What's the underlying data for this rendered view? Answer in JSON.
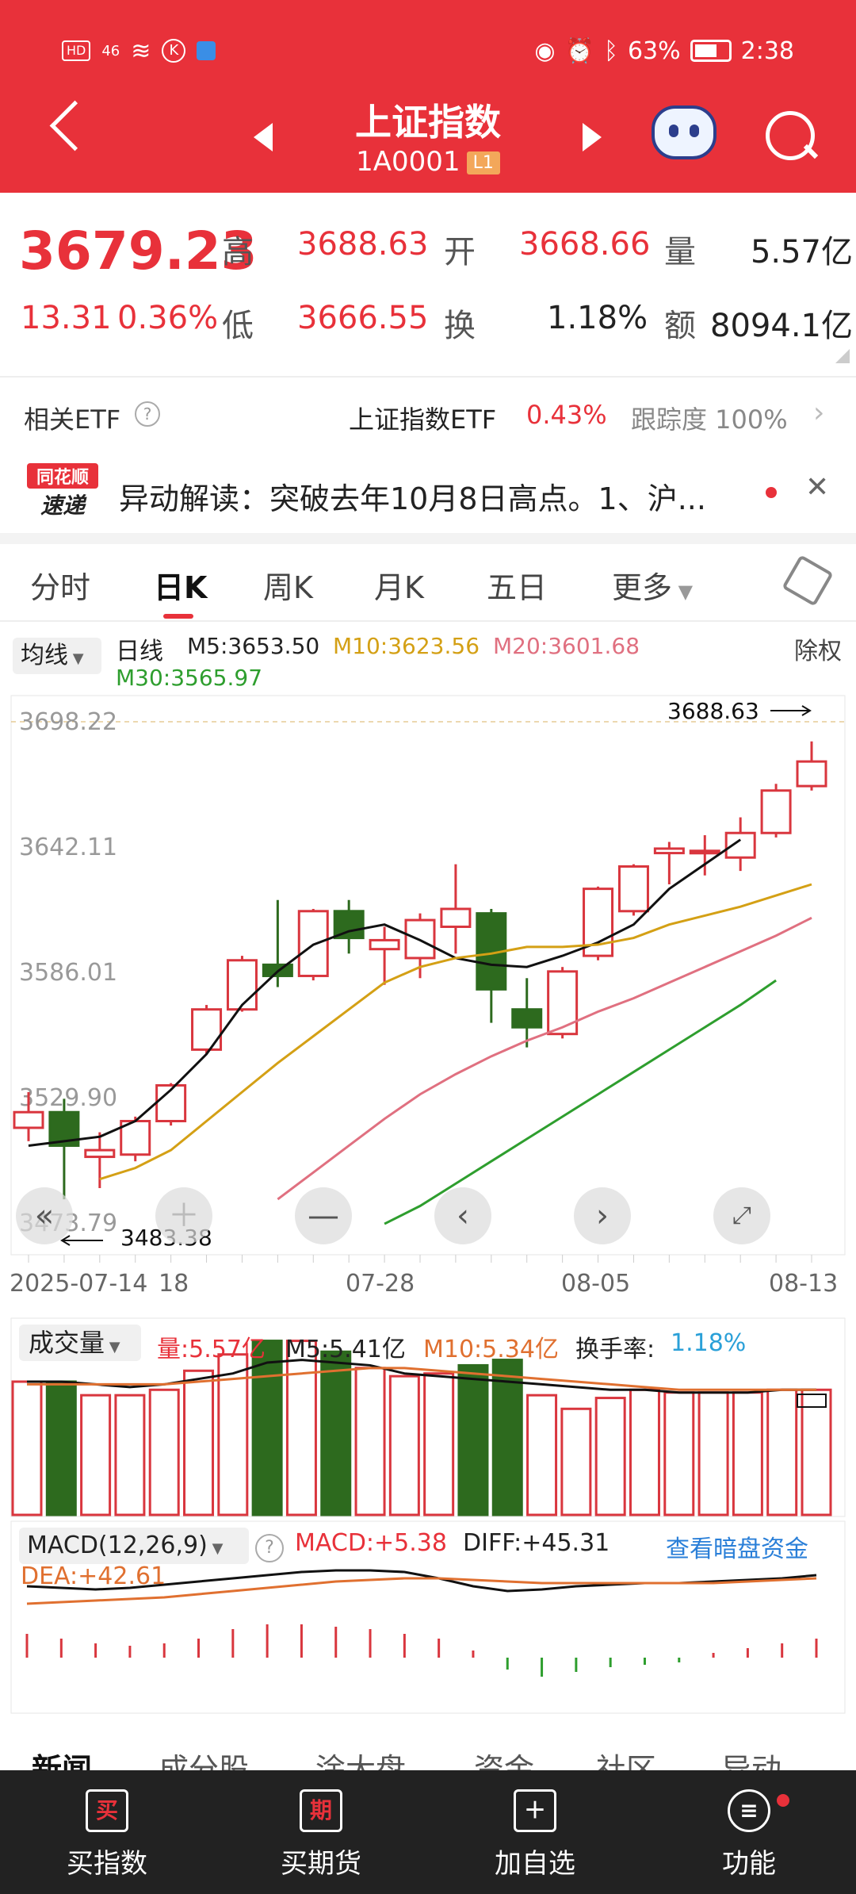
{
  "status": {
    "left": [
      "HD",
      "46",
      "K"
    ],
    "battery": "63%",
    "time": "2:38"
  },
  "header": {
    "title": "上证指数",
    "code": "1A0001",
    "badge": "L1"
  },
  "quote": {
    "price": "3679.23",
    "change": "13.31",
    "pct": "0.36%",
    "high_label": "高",
    "high": "3688.63",
    "open_label": "开",
    "open": "3668.66",
    "vol_label": "量",
    "vol": "5.57亿",
    "low_label": "低",
    "low": "3666.55",
    "turn_label": "换",
    "turn": "1.18%",
    "amt_label": "额",
    "amt": "8094.1亿"
  },
  "etf": {
    "label": "相关ETF",
    "name": "上证指数ETF",
    "pct": "0.43%",
    "track": "跟踪度 100%"
  },
  "news": {
    "logo_top": "同花顺",
    "logo_bottom": "速递",
    "text": "异动解读：突破去年10月8日高点。1、沪..."
  },
  "tabs": [
    "分时",
    "日K",
    "周K",
    "月K",
    "五日",
    "更多"
  ],
  "ma": {
    "btn": "均线",
    "label": "日线",
    "m5": "M5:3653.50",
    "m10": "M10:3623.56",
    "m20": "M20:3601.68",
    "m30": "M30:3565.97",
    "adj": "除权"
  },
  "chart_data": {
    "type": "candlestick",
    "y_ticks": [
      "3698.22",
      "3642.11",
      "3586.01",
      "3529.90",
      "3473.79"
    ],
    "ylim": [
      3473.79,
      3698.22
    ],
    "x_labels": [
      "2025-07-14",
      "18",
      "07-28",
      "08-05",
      "08-13"
    ],
    "high_label": "3688.63",
    "low_label": "3483.38",
    "candles": [
      {
        "o": 3515,
        "c": 3522,
        "h": 3531,
        "l": 3509
      },
      {
        "o": 3522,
        "c": 3507,
        "h": 3528,
        "l": 3483
      },
      {
        "o": 3502,
        "c": 3505,
        "h": 3513,
        "l": 3488
      },
      {
        "o": 3503,
        "c": 3518,
        "h": 3520,
        "l": 3500
      },
      {
        "o": 3518,
        "c": 3534,
        "h": 3535,
        "l": 3516
      },
      {
        "o": 3550,
        "c": 3568,
        "h": 3570,
        "l": 3548
      },
      {
        "o": 3568,
        "c": 3590,
        "h": 3592,
        "l": 3567
      },
      {
        "o": 3588,
        "c": 3583,
        "h": 3617,
        "l": 3578
      },
      {
        "o": 3583,
        "c": 3612,
        "h": 3613,
        "l": 3581
      },
      {
        "o": 3612,
        "c": 3600,
        "h": 3617,
        "l": 3593
      },
      {
        "o": 3595,
        "c": 3599,
        "h": 3605,
        "l": 3579
      },
      {
        "o": 3591,
        "c": 3608,
        "h": 3611,
        "l": 3582
      },
      {
        "o": 3605,
        "c": 3613,
        "h": 3633,
        "l": 3593
      },
      {
        "o": 3611,
        "c": 3577,
        "h": 3613,
        "l": 3562
      },
      {
        "o": 3568,
        "c": 3560,
        "h": 3582,
        "l": 3551
      },
      {
        "o": 3557,
        "c": 3585,
        "h": 3587,
        "l": 3555
      },
      {
        "o": 3592,
        "c": 3622,
        "h": 3623,
        "l": 3590
      },
      {
        "o": 3612,
        "c": 3632,
        "h": 3633,
        "l": 3610
      },
      {
        "o": 3638,
        "c": 3640,
        "h": 3643,
        "l": 3624
      },
      {
        "o": 3638,
        "c": 3639,
        "h": 3646,
        "l": 3628
      },
      {
        "o": 3636,
        "c": 3647,
        "h": 3654,
        "l": 3630
      },
      {
        "o": 3647,
        "c": 3666,
        "h": 3669,
        "l": 3645
      },
      {
        "o": 3668,
        "c": 3679,
        "h": 3688,
        "l": 3666
      }
    ],
    "ma5": [
      3507,
      3509,
      3511,
      3518,
      3532,
      3548,
      3570,
      3585,
      3597,
      3603,
      3606,
      3599,
      3591,
      3588,
      3587,
      3592,
      3598,
      3606,
      3622,
      3633,
      3644
    ],
    "ma10_start_index": 2,
    "ma10": [
      3492,
      3497,
      3505,
      3518,
      3531,
      3544,
      3556,
      3568,
      3580,
      3587,
      3591,
      3593,
      3596,
      3596,
      3597,
      3600,
      3606,
      3610,
      3614,
      3619,
      3624
    ],
    "ma20_start_index": 7,
    "ma20": [
      3483,
      3495,
      3507,
      3519,
      3530,
      3539,
      3547,
      3554,
      3560,
      3567,
      3573,
      3580,
      3587,
      3594,
      3601,
      3609
    ],
    "ma30_start_index": 10,
    "ma30": [
      3472,
      3480,
      3490,
      3500,
      3510,
      3520,
      3530,
      3540,
      3550,
      3560,
      3570,
      3581
    ],
    "volume": {
      "label": "成交量",
      "vol": "量:5.57亿",
      "m5": "M5:5.41亿",
      "m10": "M10:5.34亿",
      "turn_label": "换手率:",
      "turn": "1.18%",
      "values": [
        4.9,
        4.9,
        4.4,
        4.4,
        4.6,
        5.3,
        5.9,
        6.4,
        6.4,
        6.0,
        5.4,
        5.1,
        5.2,
        5.5,
        5.7,
        4.4,
        3.9,
        4.3,
        4.6,
        4.5,
        4.5,
        4.5,
        4.6,
        4.6
      ]
    },
    "macd": {
      "label": "MACD(12,26,9)",
      "macd": "MACD:+5.38",
      "diff": "DIFF:+45.31",
      "dea": "DEA:+42.61",
      "link": "查看暗盘资金",
      "bars": [
        10,
        8,
        6,
        5,
        6,
        8,
        12,
        14,
        14,
        13,
        12,
        10,
        8,
        3,
        -5,
        -8,
        -6,
        -4,
        -3,
        -2,
        2,
        4,
        6,
        8
      ]
    }
  },
  "bottom_tabs": [
    "新闻",
    "成分股",
    "涂大盘",
    "资金",
    "社区",
    "异动"
  ],
  "nav": [
    {
      "icon": "买",
      "label": "买指数"
    },
    {
      "icon": "期",
      "label": "买期货"
    },
    {
      "icon": "＋",
      "label": "加自选"
    },
    {
      "icon": "≡",
      "label": "功能"
    }
  ]
}
